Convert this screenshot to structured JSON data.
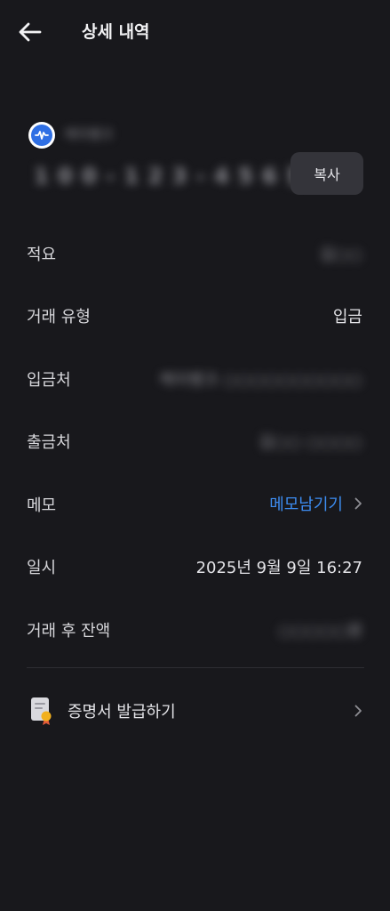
{
  "header": {
    "title": "상세 내역",
    "back_icon": "arrow-left-icon"
  },
  "account": {
    "bank_name": "케이뱅크",
    "number": "1 0 0 - 1 2 3 - 4 5 6 원",
    "copy_label": "복사",
    "logo_icon": "bank-logo-icon"
  },
  "details": [
    {
      "label": "적요",
      "value": "김○○",
      "blurred": true
    },
    {
      "label": "거래 유형",
      "value": "입금",
      "blurred": false
    },
    {
      "label": "입금처",
      "value": "케이뱅크 ○○○○○○○○○○",
      "blurred": true
    },
    {
      "label": "출금처",
      "value": "김○○ ○○○○",
      "blurred": true
    },
    {
      "label": "메모",
      "value": "메모남기기",
      "link": true
    },
    {
      "label": "일시",
      "value": "2025년 9월 9일 16:27",
      "blurred": false
    },
    {
      "label": "거래 후 잔액",
      "value": "○○○○○원",
      "blurred": true
    }
  ],
  "certificate": {
    "label": "증명서 발급하기",
    "icon": "certificate-icon"
  },
  "colors": {
    "background": "#18181c",
    "accent_link": "#3d8cf0",
    "button_bg": "#34343a",
    "logo_blue": "#2f6fe4"
  }
}
